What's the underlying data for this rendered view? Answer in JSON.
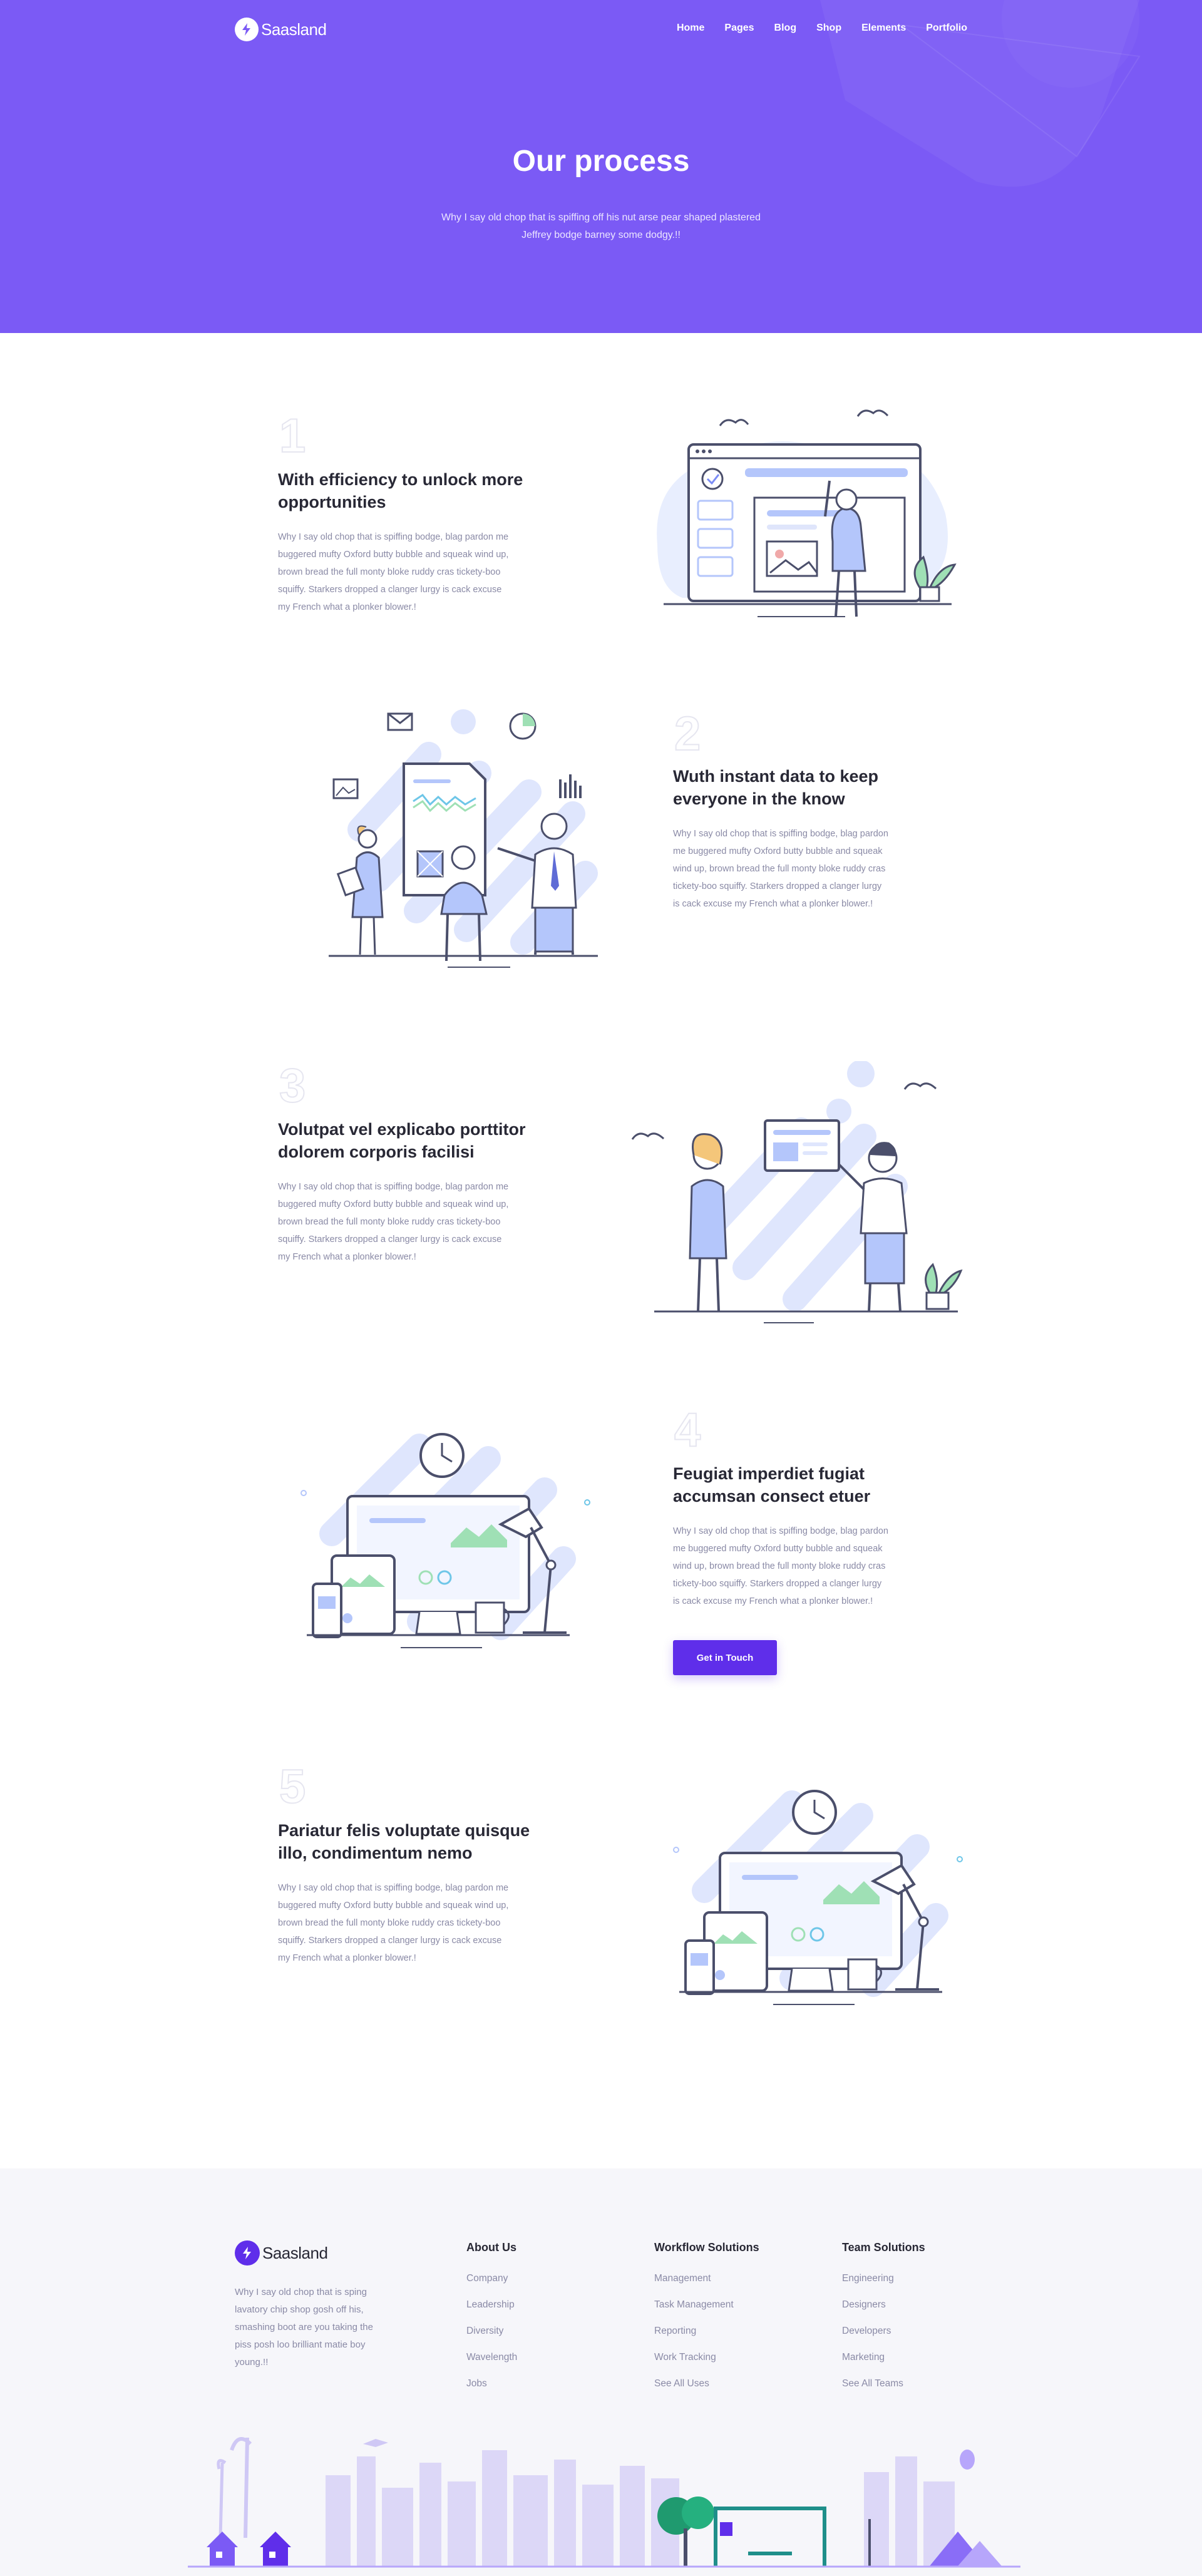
{
  "brand": {
    "name": "Saasland"
  },
  "nav": {
    "items": [
      "Home",
      "Pages",
      "Blog",
      "Shop",
      "Elements",
      "Portfolio"
    ]
  },
  "hero": {
    "title": "Our process",
    "subtitle_line1": "Why I say old chop that is spiffing off his nut arse pear shaped plastered",
    "subtitle_line2": "Jeffrey bodge barney some dodgy.!!"
  },
  "steps": [
    {
      "number": "1",
      "title_line1": "With efficiency to unlock more",
      "title_line2": "opportunities",
      "text": [
        "Why I say old chop that is spiffing bodge, blag pardon me",
        "buggered mufty Oxford butty bubble and squeak wind up,",
        "brown bread the full monty bloke ruddy cras tickety-boo",
        "squiffy. Starkers dropped a clanger lurgy is cack excuse",
        "my French what a plonker blower.!"
      ]
    },
    {
      "number": "2",
      "title_line1": "Wuth instant data to keep",
      "title_line2": "everyone in the know",
      "text": [
        "Why I say old chop that is spiffing bodge, blag pardon",
        "me buggered mufty Oxford butty bubble and squeak",
        "wind up, brown bread the full monty bloke ruddy cras",
        "tickety-boo squiffy. Starkers dropped a clanger lurgy",
        "is cack excuse my French what a plonker blower.!"
      ]
    },
    {
      "number": "3",
      "title_line1": "Volutpat vel explicabo porttitor",
      "title_line2": "dolorem corporis facilisi",
      "text": [
        "Why I say old chop that is spiffing bodge, blag pardon me",
        "buggered mufty Oxford butty bubble and squeak wind up,",
        "brown bread the full monty bloke ruddy cras tickety-boo",
        "squiffy. Starkers dropped a clanger lurgy is cack excuse",
        "my French what a plonker blower.!"
      ]
    },
    {
      "number": "4",
      "title_line1": "Feugiat imperdiet fugiat",
      "title_line2": "accumsan consect etuer",
      "text": [
        "Why I say old chop that is spiffing bodge, blag pardon",
        "me buggered mufty Oxford butty bubble and squeak",
        "wind up, brown bread the full monty bloke ruddy cras",
        "tickety-boo squiffy. Starkers dropped a clanger lurgy",
        "is cack excuse my French what a plonker blower.!"
      ]
    },
    {
      "number": "5",
      "title_line1": "Pariatur felis voluptate quisque",
      "title_line2": "illo, condimentum nemo",
      "text": [
        "Why I say old chop that is spiffing bodge, blag pardon me",
        "buggered mufty Oxford butty bubble and squeak wind up,",
        "brown bread the full monty bloke ruddy cras tickety-boo",
        "squiffy. Starkers dropped a clanger lurgy is cack excuse",
        "my French what a plonker blower.!"
      ]
    }
  ],
  "cta": {
    "label": "Get in Touch"
  },
  "footer": {
    "about": [
      "Why I say old chop that is sping",
      "lavatory chip shop gosh off his,",
      "smashing boot are you taking the",
      "piss posh loo brilliant matie boy",
      "young.!!"
    ],
    "columns": [
      {
        "title": "About Us",
        "links": [
          "Company",
          "Leadership",
          "Diversity",
          "Wavelength",
          "Jobs"
        ]
      },
      {
        "title": "Workflow Solutions",
        "links": [
          "Management",
          "Task Management",
          "Reporting",
          "Work Tracking",
          "See All Uses"
        ]
      },
      {
        "title": "Team Solutions",
        "links": [
          "Engineering",
          "Designers",
          "Developers",
          "Marketing",
          "See All Teams"
        ]
      }
    ]
  },
  "icons": {
    "logo": "lightning-bolt-icon"
  },
  "colors": {
    "hero_bg": "#7b5af5",
    "accent": "#5f2eea",
    "footer_bg": "#f6f6fa",
    "text_dark": "#282835",
    "text_muted": "#8a8aa6",
    "illustration_blue": "#b4c6fb"
  }
}
